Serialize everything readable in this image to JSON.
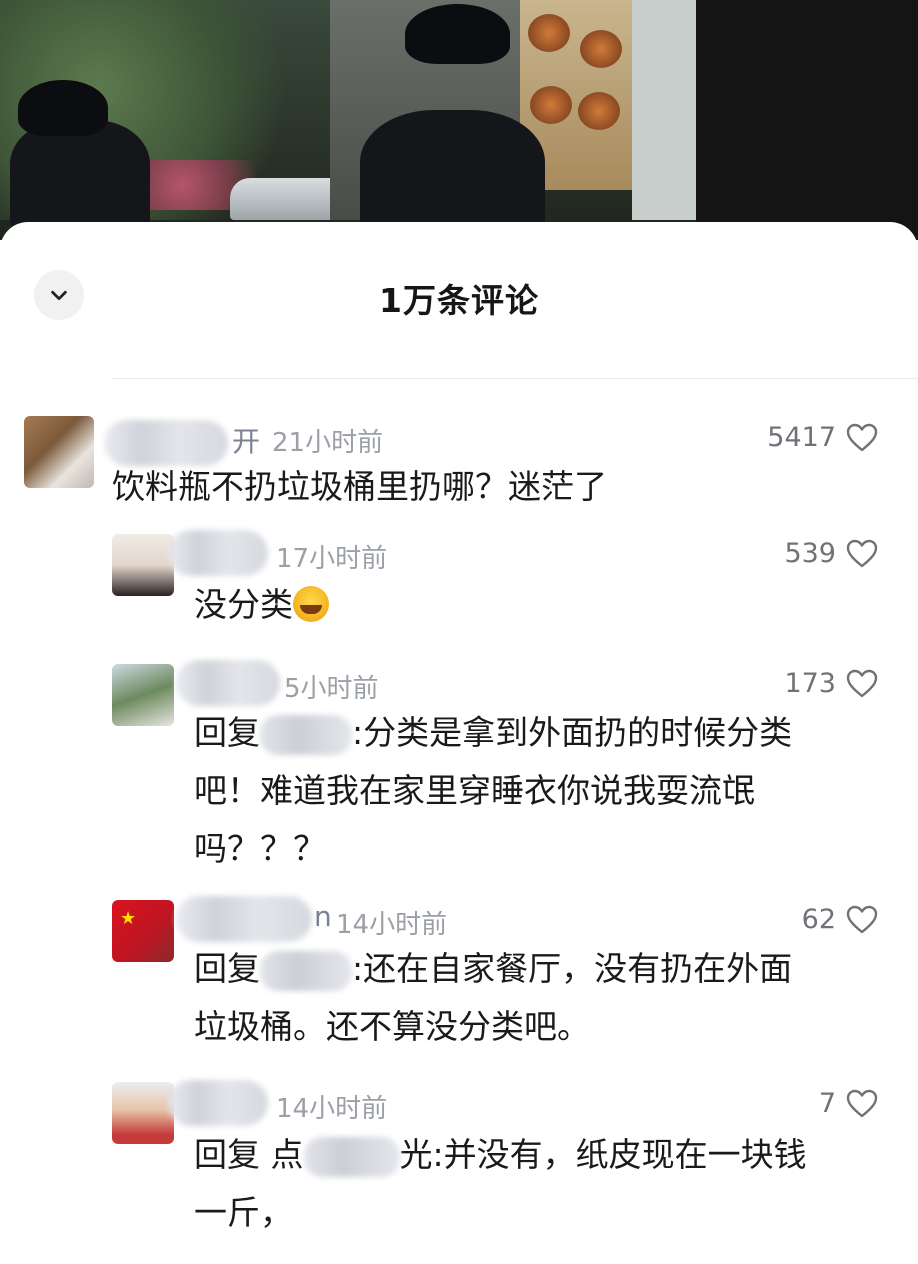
{
  "sheet": {
    "title": "1万条评论"
  },
  "comments": [
    {
      "name_tail": "开",
      "time": "21小时前",
      "likes": "5417",
      "text": "饮料瓶不扔垃圾桶里扔哪？迷茫了"
    },
    {
      "name_tail": "",
      "time": "17小时前",
      "likes": "539",
      "text": "没分类"
    },
    {
      "name_tail": "",
      "time": "5小时前",
      "likes": "173",
      "reply_prefix": "回复",
      "text_line1": ":分类是拿到外面扔的时候分类",
      "text_line2": "吧！难道我在家里穿睡衣你说我耍流氓",
      "text_line3": "吗？？？"
    },
    {
      "name_tail": "n",
      "time": "14小时前",
      "likes": "62",
      "reply_prefix": "回复",
      "text_line1": ":还在自家餐厅，没有扔在外面",
      "text_line2": "垃圾桶。还不算没分类吧。"
    },
    {
      "name_tail": "",
      "time": "14小时前",
      "likes": "7",
      "reply_prefix": "回复 点",
      "reply_suffix": "光",
      "text_line1": ":并没有，纸皮现在一块钱",
      "text_line2": "一斤，"
    }
  ],
  "icons": {
    "close": "chevron-down-icon",
    "like": "heart-outline-icon"
  }
}
